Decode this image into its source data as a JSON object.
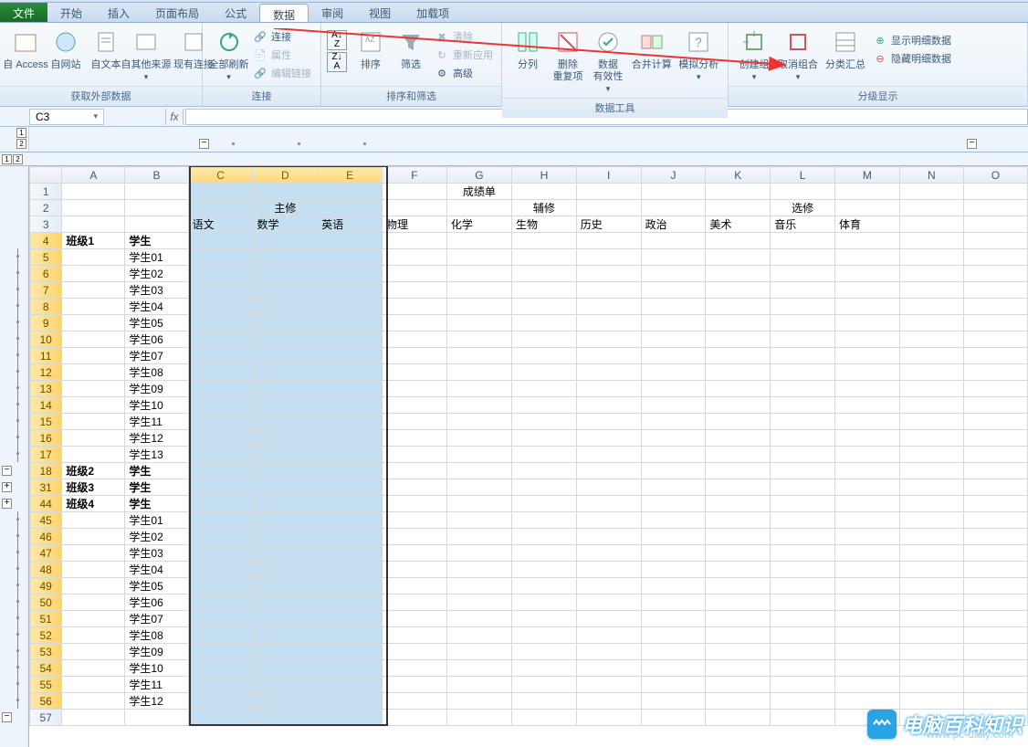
{
  "tabs": {
    "file": "文件",
    "home": "开始",
    "insert": "插入",
    "layout": "页面布局",
    "formula": "公式",
    "data": "数据",
    "review": "审阅",
    "view": "视图",
    "addin": "加载项"
  },
  "ribbon": {
    "ext": {
      "access": "自 Access",
      "web": "自网站",
      "text": "自文本",
      "other": "自其他来源",
      "existing": "现有连接",
      "group": "获取外部数据"
    },
    "conn": {
      "refresh": "全部刷新",
      "connect": "连接",
      "prop": "属性",
      "editlink": "编辑链接",
      "group": "连接"
    },
    "sort": {
      "sort": "排序",
      "filter": "筛选",
      "clear": "清除",
      "reapply": "重新应用",
      "adv": "高级",
      "group": "排序和筛选"
    },
    "tools": {
      "ttc": "分列",
      "dup": "删除\n重复项",
      "valid": "数据\n有效性",
      "consol": "合并计算",
      "whatif": "模拟分析",
      "group": "数据工具"
    },
    "out": {
      "groupb": "创建组",
      "ungroup": "取消组合",
      "subtotal": "分类汇总",
      "show": "显示明细数据",
      "hide": "隐藏明细数据",
      "group": "分级显示"
    }
  },
  "namebox": "C3",
  "columns": [
    "A",
    "B",
    "C",
    "D",
    "E",
    "F",
    "G",
    "H",
    "I",
    "J",
    "K",
    "L",
    "M",
    "N",
    "O"
  ],
  "sel_cols": [
    "C",
    "D",
    "E"
  ],
  "headers": {
    "title": "成绩单",
    "major": "主修",
    "minor": "辅修",
    "elect": "选修",
    "subjects": [
      "语文",
      "数学",
      "英语",
      "物理",
      "化学",
      "生物",
      "历史",
      "政治",
      "美术",
      "音乐",
      "体育"
    ]
  },
  "rows": [
    {
      "n": 1
    },
    {
      "n": 2
    },
    {
      "n": 3
    },
    {
      "n": 4,
      "a": "班级1",
      "b": "学生",
      "bold": true,
      "gold": true
    },
    {
      "n": 5,
      "b": "学生01",
      "gold": true
    },
    {
      "n": 6,
      "b": "学生02",
      "gold": true
    },
    {
      "n": 7,
      "b": "学生03",
      "gold": true
    },
    {
      "n": 8,
      "b": "学生04",
      "gold": true
    },
    {
      "n": 9,
      "b": "学生05",
      "gold": true
    },
    {
      "n": 10,
      "b": "学生06",
      "gold": true
    },
    {
      "n": 11,
      "b": "学生07",
      "gold": true
    },
    {
      "n": 12,
      "b": "学生08",
      "gold": true
    },
    {
      "n": 13,
      "b": "学生09",
      "gold": true
    },
    {
      "n": 14,
      "b": "学生10",
      "gold": true
    },
    {
      "n": 15,
      "b": "学生11",
      "gold": true
    },
    {
      "n": 16,
      "b": "学生12",
      "gold": true
    },
    {
      "n": 17,
      "b": "学生13",
      "gold": true
    },
    {
      "n": 18,
      "a": "班级2",
      "b": "学生",
      "bold": true,
      "gold": true,
      "box": "-"
    },
    {
      "n": 31,
      "a": "班级3",
      "b": "学生",
      "bold": true,
      "gold": true,
      "box": "+"
    },
    {
      "n": 44,
      "a": "班级4",
      "b": "学生",
      "bold": true,
      "gold": true,
      "box": "+"
    },
    {
      "n": 45,
      "b": "学生01",
      "gold": true
    },
    {
      "n": 46,
      "b": "学生02",
      "gold": true
    },
    {
      "n": 47,
      "b": "学生03",
      "gold": true
    },
    {
      "n": 48,
      "b": "学生04",
      "gold": true
    },
    {
      "n": 49,
      "b": "学生05",
      "gold": true
    },
    {
      "n": 50,
      "b": "学生06",
      "gold": true
    },
    {
      "n": 51,
      "b": "学生07",
      "gold": true
    },
    {
      "n": 52,
      "b": "学生08",
      "gold": true
    },
    {
      "n": 53,
      "b": "学生09",
      "gold": true
    },
    {
      "n": 54,
      "b": "学生10",
      "gold": true
    },
    {
      "n": 55,
      "b": "学生11",
      "gold": true
    },
    {
      "n": 56,
      "b": "学生12",
      "gold": true
    },
    {
      "n": 57,
      "box": "-"
    }
  ],
  "watermark": {
    "brand": "电脑百科知识",
    "url": "www.pc-daily.com"
  }
}
